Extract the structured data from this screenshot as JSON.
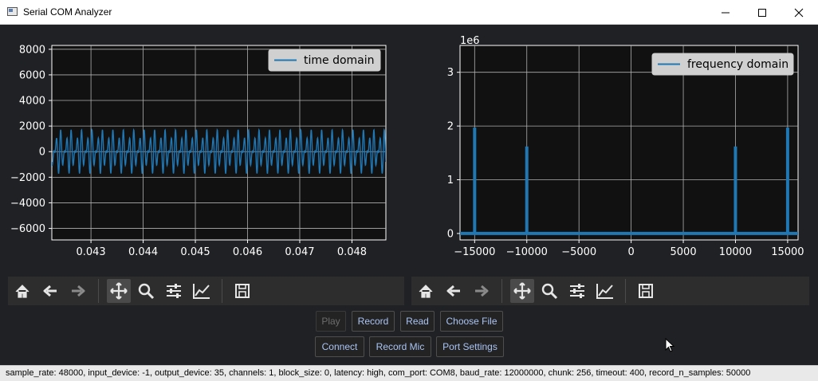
{
  "window": {
    "title": "Serial COM Analyzer"
  },
  "chart_data": [
    {
      "type": "line",
      "legend": [
        "time domain"
      ],
      "legend_position": "top-right",
      "grid": true,
      "xlim": [
        0.04225,
        0.04865
      ],
      "ylim": [
        -6900,
        8300
      ],
      "xticks": [
        0.043,
        0.044,
        0.045,
        0.046,
        0.047,
        0.048
      ],
      "yticks": [
        -6000,
        -4000,
        -2000,
        0,
        2000,
        4000,
        6000,
        8000
      ],
      "xtick_labels": [
        "0.043",
        "0.044",
        "0.045",
        "0.046",
        "0.047",
        "0.048"
      ],
      "ytick_labels": [
        "−6000",
        "−4000",
        "−2000",
        "0",
        "2000",
        "4000",
        "6000",
        "8000"
      ],
      "series": [
        {
          "name": "time domain",
          "color": "#1f77b4",
          "signal": {
            "components": [
              {
                "amplitude": 1000,
                "frequency_hz": 10000
              },
              {
                "amplitude": 800,
                "frequency_hz": 15000
              }
            ]
          }
        }
      ]
    },
    {
      "type": "line",
      "legend": [
        "frequency domain"
      ],
      "legend_position": "top-right",
      "grid": true,
      "scale_label": "1e6",
      "xlim": [
        -16400,
        16000
      ],
      "ylim": [
        -0.12,
        3.5
      ],
      "xticks": [
        -15000,
        -10000,
        -5000,
        0,
        5000,
        10000,
        15000
      ],
      "yticks": [
        0,
        1,
        2,
        3
      ],
      "xtick_labels": [
        "−15000",
        "−10000",
        "−5000",
        "0",
        "5000",
        "10000",
        "15000"
      ],
      "ytick_labels": [
        "0",
        "1",
        "2",
        "3"
      ],
      "series": [
        {
          "name": "frequency domain",
          "color": "#1f77b4",
          "peaks": [
            {
              "x": -15000,
              "y": 1.97
            },
            {
              "x": -10000,
              "y": 1.62
            },
            {
              "x": 10000,
              "y": 1.62
            },
            {
              "x": 15000,
              "y": 1.97
            }
          ],
          "baseline": 0
        }
      ]
    }
  ],
  "toolbar_icons": [
    "home-icon",
    "back-arrow-icon",
    "forward-arrow-icon",
    "pan-icon",
    "zoom-icon",
    "configure-subplots-icon",
    "edit-axis-icon",
    "save-icon"
  ],
  "buttons": {
    "play": "Play",
    "record": "Record",
    "read": "Read",
    "choose_file": "Choose File",
    "connect": "Connect",
    "record_mic": "Record Mic",
    "port_settings": "Port Settings"
  },
  "status": "sample_rate: 48000, input_device: -1, output_device: 35, channels: 1, block_size: 0, latency: high, com_port: COM8, baud_rate: 12000000, chunk: 256, timeout: 400, record_n_samples: 50000"
}
